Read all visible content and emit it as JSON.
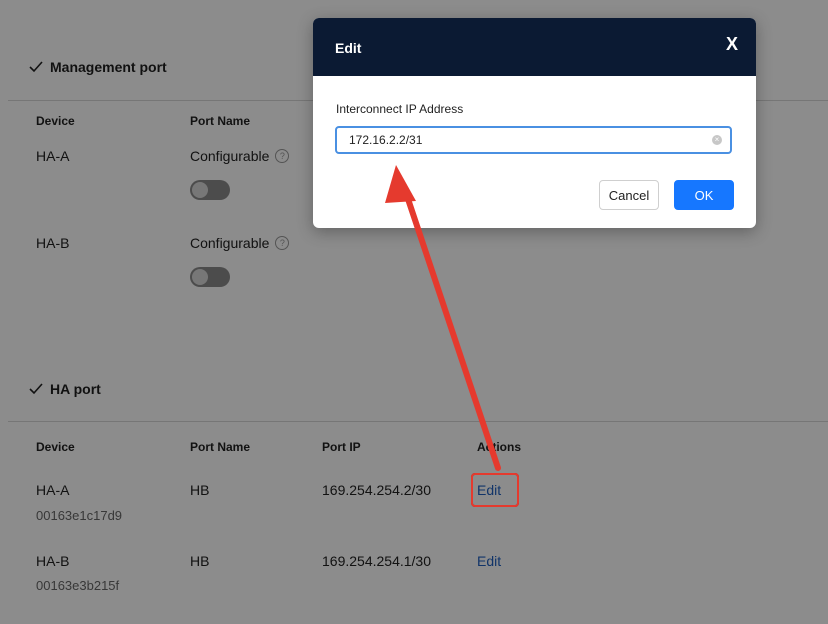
{
  "management": {
    "title": "Management port",
    "headers": {
      "device": "Device",
      "port_name": "Port Name"
    },
    "rows": [
      {
        "device": "HA-A",
        "port_name": "Configurable",
        "help": "?"
      },
      {
        "device": "HA-B",
        "port_name": "Configurable",
        "help": "?"
      }
    ]
  },
  "ha": {
    "title": "HA port",
    "headers": {
      "device": "Device",
      "port_name": "Port Name",
      "port_ip": "Port IP",
      "actions": "Actions"
    },
    "rows": [
      {
        "device": "HA-A",
        "serial": "00163e1c17d9",
        "port_name": "HB",
        "port_ip": "169.254.254.2/30",
        "action": "Edit"
      },
      {
        "device": "HA-B",
        "serial": "00163e3b215f",
        "port_name": "HB",
        "port_ip": "169.254.254.1/30",
        "action": "Edit"
      }
    ]
  },
  "modal": {
    "title": "Edit",
    "close": "X",
    "field_label": "Interconnect IP Address",
    "field_value": "172.16.2.2/31",
    "clear_glyph": "×",
    "cancel": "Cancel",
    "ok": "OK"
  },
  "colors": {
    "modal_header": "#0b1a33",
    "primary": "#1677ff",
    "link": "#1f5fbf",
    "annotation": "#e53a2e"
  }
}
